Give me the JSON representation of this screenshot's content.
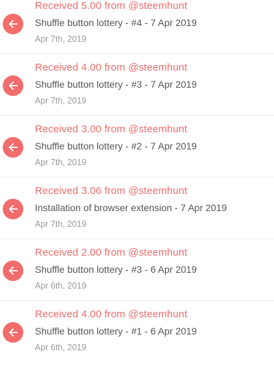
{
  "colors": {
    "accent": "#f06b6b",
    "icon_bg": "#f26c6c",
    "memo_text": "#555555",
    "date_text": "#9a9a9a",
    "divider": "#ececec"
  },
  "transactions": [
    {
      "icon": "left-arrow-icon",
      "title": "Received 5.00 from @steemhunt",
      "memo": "Shuffle button lottery - #4 - 7 Apr 2019",
      "date": "Apr 7th, 2019"
    },
    {
      "icon": "left-arrow-icon",
      "title": "Received 4.00 from @steemhunt",
      "memo": "Shuffle button lottery - #3 - 7 Apr 2019",
      "date": "Apr 7th, 2019"
    },
    {
      "icon": "left-arrow-icon",
      "title": "Received 3.00 from @steemhunt",
      "memo": "Shuffle button lottery - #2 - 7 Apr 2019",
      "date": "Apr 7th, 2019"
    },
    {
      "icon": "left-arrow-icon",
      "title": "Received 3.06 from @steemhunt",
      "memo": "Installation of browser extension - 7 Apr 2019",
      "date": "Apr 7th, 2019"
    },
    {
      "icon": "left-arrow-icon",
      "title": "Received 2.00 from @steemhunt",
      "memo": "Shuffle button lottery - #3 - 6 Apr 2019",
      "date": "Apr 6th, 2019"
    },
    {
      "icon": "left-arrow-icon",
      "title": "Received 4.00 from @steemhunt",
      "memo": "Shuffle button lottery - #1 - 6 Apr 2019",
      "date": "Apr 6th, 2019"
    }
  ]
}
